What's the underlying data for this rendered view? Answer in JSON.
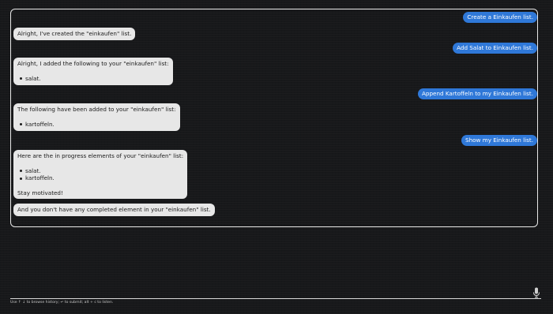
{
  "messages": {
    "m1": {
      "role": "user",
      "text": "Create a Einkaufen list."
    },
    "m2": {
      "role": "bot",
      "text": "Alright, I've created the \"einkaufen\" list."
    },
    "m3": {
      "role": "user",
      "text": "Add Salat to Einkaufen list."
    },
    "m4": {
      "role": "bot",
      "intro": "Alright, I added the following to your \"einkaufen\" list:",
      "items": [
        "salat."
      ]
    },
    "m5": {
      "role": "user",
      "text": "Append Kartoffeln to my Einkaufen list."
    },
    "m6": {
      "role": "bot",
      "intro": "The following have been added to your \"einkaufen\" list:",
      "items": [
        "kartoffeln."
      ]
    },
    "m7": {
      "role": "user",
      "text": "Show my Einkaufen list."
    },
    "m8": {
      "role": "bot",
      "intro": "Here are the in progress elements of your \"einkaufen\" list:",
      "items": [
        "salat.",
        "kartoffeln."
      ],
      "outro": "Stay motivated!"
    },
    "m9": {
      "role": "bot",
      "text": "And you don't have any completed element in your \"einkaufen\" list."
    }
  },
  "input": {
    "value": "",
    "hint": "Use ↑ ↓ to browse history; ↵ to submit; alt + c to listen."
  },
  "icons": {
    "mic": "microphone-icon"
  },
  "colors": {
    "background": "#17181a",
    "user_bubble": "#2f78d8",
    "bot_bubble": "#e7e7e7",
    "panel_border": "#e8e8e8"
  }
}
